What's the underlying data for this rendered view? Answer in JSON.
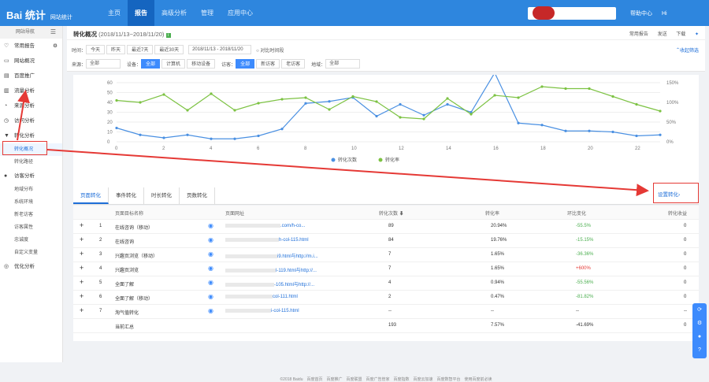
{
  "top": {
    "logo": "Bai 统计",
    "logo_sub": "网站统计",
    "nav": [
      "主页",
      "报告",
      "高级分析",
      "管理",
      "应用中心"
    ],
    "help": "帮助中心",
    "user": "Hi"
  },
  "sidebar": {
    "nav_title": "网站导航",
    "items": [
      "常用报告",
      "网站概况",
      "百度推广",
      "流量分析",
      "来源分析",
      "访问分析",
      "转化分析"
    ],
    "conv_subs": [
      "转化概况",
      "转化路径"
    ],
    "visitor": "访客分析",
    "visitor_subs": [
      "地域分布",
      "系统环境",
      "新老访客",
      "访客属性",
      "忠诚度",
      "自定义变量"
    ],
    "optimize": "优化分析"
  },
  "title": {
    "text": "转化概况",
    "range": "(2018/11/13~2018/11/20)",
    "actions": [
      "常用报告",
      "发送",
      "下载"
    ]
  },
  "filters": {
    "time_label": "时间：",
    "time_opts": [
      "今天",
      "昨天",
      "最近7天",
      "最近30天"
    ],
    "date_range": "2018/11/13 - 2018/11/20",
    "compare": "对比时间段",
    "collapse": "收起筛选",
    "source_label": "来源：",
    "source_val": "全部",
    "device_label": "设备：",
    "device_opts": [
      "全部",
      "计算机",
      "移动设备"
    ],
    "visitor_label": "访客：",
    "visitor_opts": [
      "全部",
      "新访客",
      "老访客"
    ],
    "region_label": "地域：",
    "region_val": "全部"
  },
  "chart_data": {
    "type": "line",
    "x": [
      0,
      1,
      2,
      3,
      4,
      5,
      6,
      7,
      8,
      9,
      10,
      11,
      12,
      13,
      14,
      15,
      16,
      17,
      18,
      19,
      20,
      21,
      22,
      23
    ],
    "series": [
      {
        "name": "转化次数",
        "color": "#4a90e2",
        "axis": "left",
        "values": [
          14,
          7,
          4,
          7,
          3,
          3,
          6,
          13,
          39,
          41,
          45,
          26,
          38,
          27,
          38,
          30,
          70,
          19,
          17,
          11,
          11,
          10,
          6,
          7
        ]
      },
      {
        "name": "转化率",
        "color": "#7cc242",
        "axis": "right",
        "values": [
          105,
          100,
          120,
          80,
          122,
          80,
          98,
          108,
          112,
          82,
          115,
          102,
          62,
          58,
          110,
          70,
          118,
          112,
          140,
          135,
          135,
          115,
          95,
          78
        ]
      }
    ],
    "ylim_left": [
      0,
      60
    ],
    "yticks_left": [
      0,
      10,
      20,
      30,
      40,
      50,
      60
    ],
    "ylim_right": [
      0,
      150
    ],
    "yticks_right": [
      "0%",
      "50%",
      "100%",
      "150%"
    ],
    "xticks": [
      0,
      2,
      4,
      6,
      8,
      10,
      12,
      14,
      16,
      18,
      20,
      22
    ],
    "legend": "bottom-center"
  },
  "tabs": [
    "页面转化",
    "事件转化",
    "时长转化",
    "页数转化"
  ],
  "setting": "设置转化›",
  "table": {
    "headers": [
      "页面目标名称",
      "页面网址",
      "转化次数",
      "转化率",
      "环比变化",
      "转化收益"
    ],
    "rows": [
      {
        "no": "1",
        "name": "在线咨询（移动）",
        "url": ".com/h-co...",
        "count": "89",
        "rate": "20.94%",
        "change": "-55.5%",
        "rev": "0"
      },
      {
        "no": "2",
        "name": "在线咨询",
        "url": "h-col-115.html",
        "count": "84",
        "rate": "19.76%",
        "change": "-15.15%",
        "rev": "0"
      },
      {
        "no": "3",
        "name": "兴趣页浏览（移动）",
        "url": "i9.html与http://m.i...",
        "count": "7",
        "rate": "1.65%",
        "change": "-36.36%",
        "rev": "0"
      },
      {
        "no": "4",
        "name": "兴趣页浏览",
        "url": "l-119.html与http://...",
        "count": "7",
        "rate": "1.65%",
        "change": "+600%",
        "rev": "0"
      },
      {
        "no": "5",
        "name": "全面了解",
        "url": "-105.html与http://...",
        "count": "4",
        "rate": "0.94%",
        "change": "-55.56%",
        "rev": "0"
      },
      {
        "no": "6",
        "name": "全面了解（移动）",
        "url": "col-111.html",
        "count": "2",
        "rate": "0.47%",
        "change": "-81.82%",
        "rev": "0"
      },
      {
        "no": "7",
        "name": "淘气值转化",
        "url": "i-col-115.html",
        "count": "--",
        "rate": "--",
        "change": "--",
        "rev": "--"
      }
    ],
    "summary": {
      "label": "当前汇总",
      "count": "193",
      "rate": "7.57%",
      "change": "-41.69%",
      "rev": "0"
    }
  },
  "footer": "©2018 Baidu　百度首页　百度推广　百度联盟　百度广告管家　百度指数　百度云加速　百度数智平台　使用百度前必读"
}
